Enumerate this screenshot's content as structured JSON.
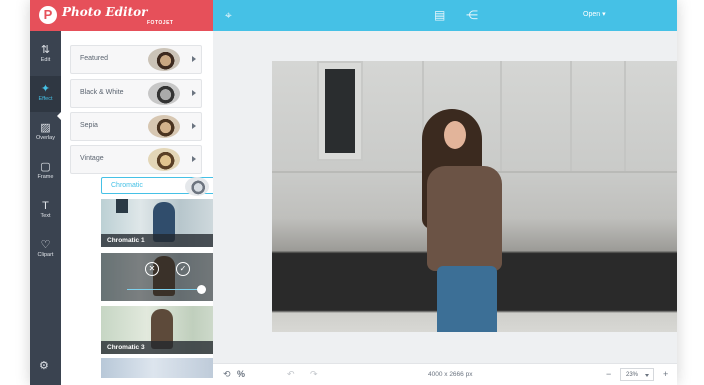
{
  "app": {
    "title": "Photo Editor",
    "subtitle": "FOTOJET",
    "badge": "P"
  },
  "topbar": {
    "open_label": "Open ▾"
  },
  "rail": {
    "items": [
      {
        "label": "Edit",
        "icon": "⇅"
      },
      {
        "label": "Effect",
        "icon": "✦"
      },
      {
        "label": "Overlay",
        "icon": "▨"
      },
      {
        "label": "Frame",
        "icon": "▢"
      },
      {
        "label": "Text",
        "icon": "T"
      },
      {
        "label": "Clipart",
        "icon": "♡"
      }
    ],
    "active": "Effect",
    "settings_icon": "⚙"
  },
  "effects_panel": {
    "categories": [
      "Featured",
      "Black & White",
      "Sepia",
      "Vintage"
    ],
    "expanded_category": "Chromatic",
    "filters": [
      {
        "label": "Chromatic 1"
      },
      {
        "label": "",
        "state": "active"
      },
      {
        "label": "Chromatic 3"
      }
    ],
    "active_controls": {
      "cancel_icon": "✕",
      "apply_icon": "✓",
      "intensity": 1.0
    }
  },
  "bottombar": {
    "reset_icon": "⟲",
    "compare_icon": "%",
    "undo_icon": "↶",
    "redo_icon": "↷",
    "dimensions": "4000 x 2666 px",
    "zoom_out": "−",
    "zoom_value": "23%",
    "zoom_in": "+"
  },
  "colors": {
    "brand": "#e6505a",
    "accent": "#45c1e6",
    "rail": "#3a4350"
  }
}
